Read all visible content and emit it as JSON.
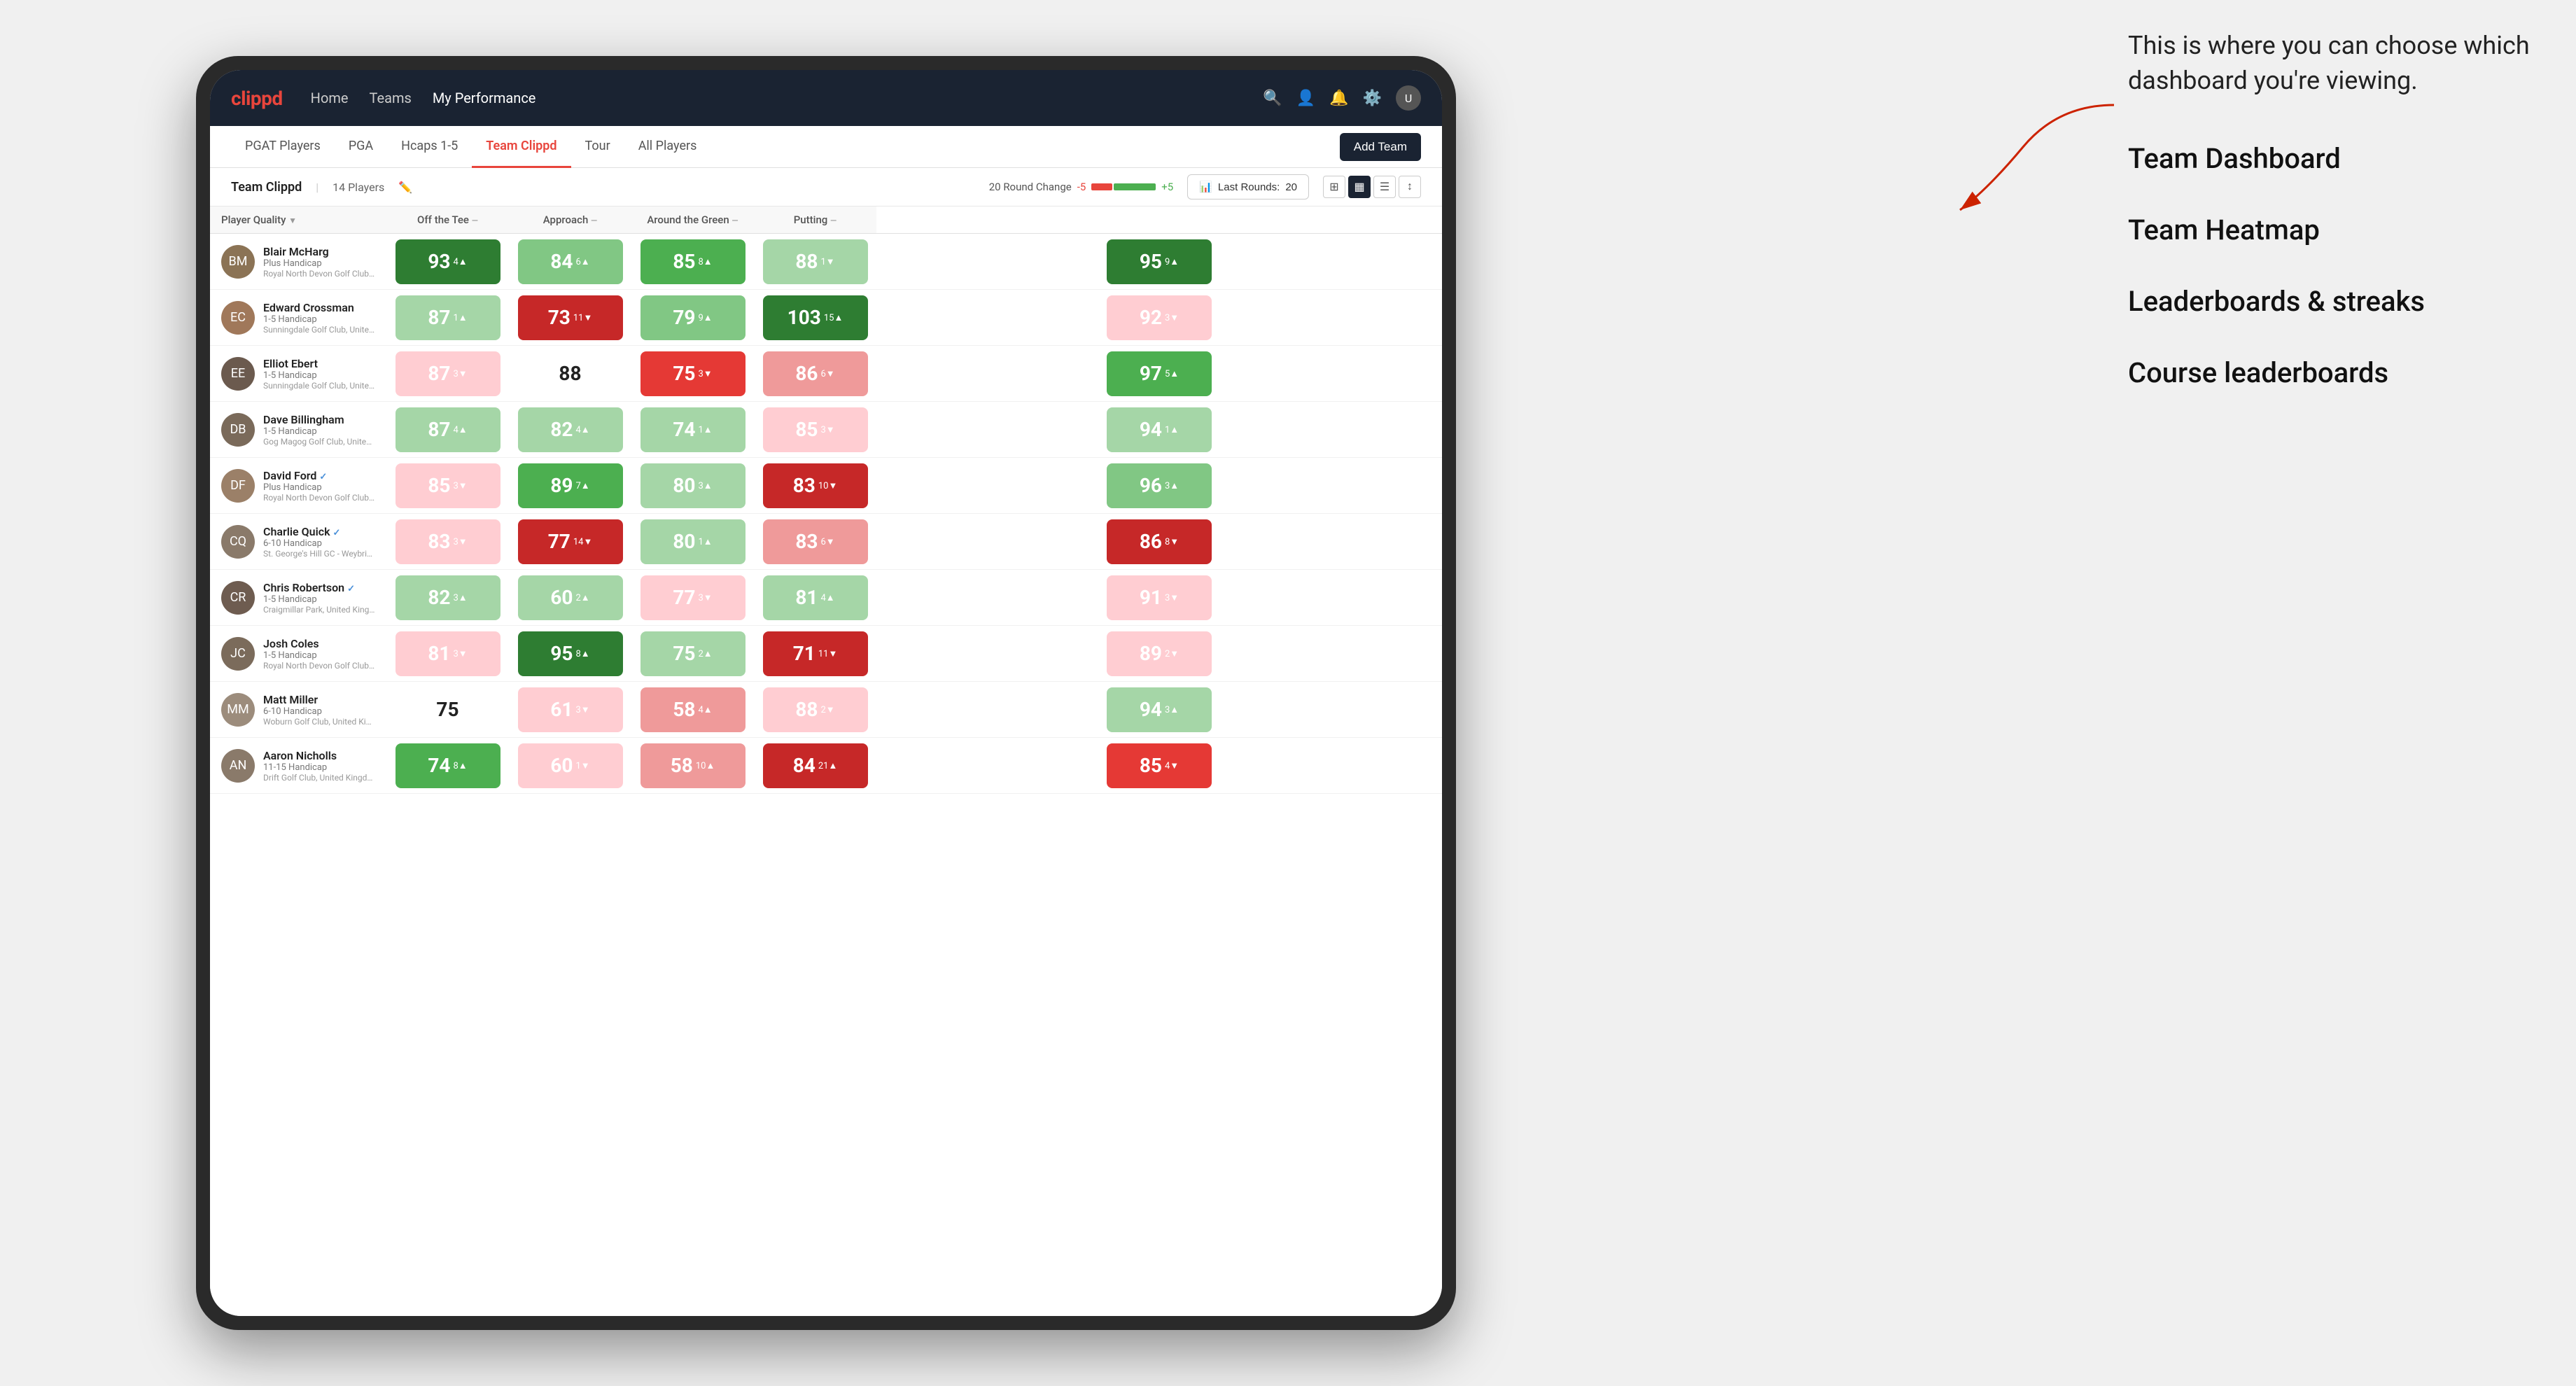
{
  "annotation": {
    "callout": "This is where you can choose which dashboard you're viewing.",
    "items": [
      "Team Dashboard",
      "Team Heatmap",
      "Leaderboards & streaks",
      "Course leaderboards"
    ]
  },
  "nav": {
    "logo": "clippd",
    "links": [
      "Home",
      "Teams",
      "My Performance"
    ],
    "active_link": "My Performance"
  },
  "sub_nav": {
    "links": [
      "PGAT Players",
      "PGA",
      "Hcaps 1-5",
      "Team Clippd",
      "Tour",
      "All Players"
    ],
    "active_link": "Team Clippd",
    "add_team_label": "Add Team"
  },
  "team_info": {
    "name": "Team Clippd",
    "separator": "|",
    "players_count": "14 Players",
    "round_change_label": "20 Round Change",
    "change_minus": "-5",
    "change_plus": "+5",
    "last_rounds_label": "Last Rounds:",
    "last_rounds_value": "20"
  },
  "table": {
    "columns": [
      {
        "label": "Player Quality",
        "sortable": true
      },
      {
        "label": "Off the Tee",
        "sortable": true
      },
      {
        "label": "Approach",
        "sortable": true
      },
      {
        "label": "Around the Green",
        "sortable": true
      },
      {
        "label": "Putting",
        "sortable": true
      }
    ],
    "players": [
      {
        "name": "Blair McHarg",
        "handicap": "Plus Handicap",
        "club": "Royal North Devon Golf Club, United Kingdom",
        "avatar_color": "#8B7355",
        "initials": "BM",
        "metrics": [
          {
            "value": "93",
            "change": "4",
            "dir": "up",
            "color": "green-dark"
          },
          {
            "value": "84",
            "change": "6",
            "dir": "up",
            "color": "green-light"
          },
          {
            "value": "85",
            "change": "8",
            "dir": "up",
            "color": "green-med"
          },
          {
            "value": "88",
            "change": "1",
            "dir": "down",
            "color": "green-pale"
          },
          {
            "value": "95",
            "change": "9",
            "dir": "up",
            "color": "green-dark"
          }
        ]
      },
      {
        "name": "Edward Crossman",
        "handicap": "1-5 Handicap",
        "club": "Sunningdale Golf Club, United Kingdom",
        "avatar_color": "#A0785A",
        "initials": "EC",
        "metrics": [
          {
            "value": "87",
            "change": "1",
            "dir": "up",
            "color": "green-pale"
          },
          {
            "value": "73",
            "change": "11",
            "dir": "down",
            "color": "red-dark"
          },
          {
            "value": "79",
            "change": "9",
            "dir": "up",
            "color": "green-light"
          },
          {
            "value": "103",
            "change": "15",
            "dir": "up",
            "color": "green-dark"
          },
          {
            "value": "92",
            "change": "3",
            "dir": "down",
            "color": "red-pale"
          }
        ]
      },
      {
        "name": "Elliot Ebert",
        "handicap": "1-5 Handicap",
        "club": "Sunningdale Golf Club, United Kingdom",
        "avatar_color": "#6B5A4E",
        "initials": "EE",
        "metrics": [
          {
            "value": "87",
            "change": "3",
            "dir": "down",
            "color": "red-pale"
          },
          {
            "value": "88",
            "change": "",
            "dir": "none",
            "color": "neutral"
          },
          {
            "value": "75",
            "change": "3",
            "dir": "down",
            "color": "red-med"
          },
          {
            "value": "86",
            "change": "6",
            "dir": "down",
            "color": "red-light"
          },
          {
            "value": "97",
            "change": "5",
            "dir": "up",
            "color": "green-med"
          }
        ]
      },
      {
        "name": "Dave Billingham",
        "handicap": "1-5 Handicap",
        "club": "Gog Magog Golf Club, United Kingdom",
        "avatar_color": "#7A6A5A",
        "initials": "DB",
        "metrics": [
          {
            "value": "87",
            "change": "4",
            "dir": "up",
            "color": "green-pale"
          },
          {
            "value": "82",
            "change": "4",
            "dir": "up",
            "color": "green-pale"
          },
          {
            "value": "74",
            "change": "1",
            "dir": "up",
            "color": "green-pale"
          },
          {
            "value": "85",
            "change": "3",
            "dir": "down",
            "color": "red-pale"
          },
          {
            "value": "94",
            "change": "1",
            "dir": "up",
            "color": "green-pale"
          }
        ]
      },
      {
        "name": "David Ford",
        "handicap": "Plus Handicap",
        "club": "Royal North Devon Golf Club, United Kingdom",
        "avatar_color": "#9B8068",
        "initials": "DF",
        "verified": true,
        "metrics": [
          {
            "value": "85",
            "change": "3",
            "dir": "down",
            "color": "red-pale"
          },
          {
            "value": "89",
            "change": "7",
            "dir": "up",
            "color": "green-med"
          },
          {
            "value": "80",
            "change": "3",
            "dir": "up",
            "color": "green-pale"
          },
          {
            "value": "83",
            "change": "10",
            "dir": "down",
            "color": "red-dark"
          },
          {
            "value": "96",
            "change": "3",
            "dir": "up",
            "color": "green-light"
          }
        ]
      },
      {
        "name": "Charlie Quick",
        "handicap": "6-10 Handicap",
        "club": "St. George's Hill GC - Weybridge - Surrey, Uni...",
        "avatar_color": "#8A7A6A",
        "initials": "CQ",
        "verified": true,
        "metrics": [
          {
            "value": "83",
            "change": "3",
            "dir": "down",
            "color": "red-pale"
          },
          {
            "value": "77",
            "change": "14",
            "dir": "down",
            "color": "red-dark"
          },
          {
            "value": "80",
            "change": "1",
            "dir": "up",
            "color": "green-pale"
          },
          {
            "value": "83",
            "change": "6",
            "dir": "down",
            "color": "red-light"
          },
          {
            "value": "86",
            "change": "8",
            "dir": "down",
            "color": "red-dark"
          }
        ]
      },
      {
        "name": "Chris Robertson",
        "handicap": "1-5 Handicap",
        "club": "Craigmillar Park, United Kingdom",
        "avatar_color": "#6E5C50",
        "initials": "CR",
        "verified": true,
        "metrics": [
          {
            "value": "82",
            "change": "3",
            "dir": "up",
            "color": "green-pale"
          },
          {
            "value": "60",
            "change": "2",
            "dir": "up",
            "color": "green-pale"
          },
          {
            "value": "77",
            "change": "3",
            "dir": "down",
            "color": "red-pale"
          },
          {
            "value": "81",
            "change": "4",
            "dir": "up",
            "color": "green-pale"
          },
          {
            "value": "91",
            "change": "3",
            "dir": "down",
            "color": "red-pale"
          }
        ]
      },
      {
        "name": "Josh Coles",
        "handicap": "1-5 Handicap",
        "club": "Royal North Devon Golf Club, United Kingdom",
        "avatar_color": "#7B6B5B",
        "initials": "JC",
        "metrics": [
          {
            "value": "81",
            "change": "3",
            "dir": "down",
            "color": "red-pale"
          },
          {
            "value": "95",
            "change": "8",
            "dir": "up",
            "color": "green-dark"
          },
          {
            "value": "75",
            "change": "2",
            "dir": "up",
            "color": "green-pale"
          },
          {
            "value": "71",
            "change": "11",
            "dir": "down",
            "color": "red-dark"
          },
          {
            "value": "89",
            "change": "2",
            "dir": "down",
            "color": "red-pale"
          }
        ]
      },
      {
        "name": "Matt Miller",
        "handicap": "6-10 Handicap",
        "club": "Woburn Golf Club, United Kingdom",
        "avatar_color": "#9C8C7C",
        "initials": "MM",
        "metrics": [
          {
            "value": "75",
            "change": "",
            "dir": "none",
            "color": "neutral"
          },
          {
            "value": "61",
            "change": "3",
            "dir": "down",
            "color": "red-pale"
          },
          {
            "value": "58",
            "change": "4",
            "dir": "up",
            "color": "red-light"
          },
          {
            "value": "88",
            "change": "2",
            "dir": "down",
            "color": "red-pale"
          },
          {
            "value": "94",
            "change": "3",
            "dir": "up",
            "color": "green-pale"
          }
        ]
      },
      {
        "name": "Aaron Nicholls",
        "handicap": "11-15 Handicap",
        "club": "Drift Golf Club, United Kingdom",
        "avatar_color": "#8A7A6A",
        "initials": "AN",
        "metrics": [
          {
            "value": "74",
            "change": "8",
            "dir": "up",
            "color": "green-med"
          },
          {
            "value": "60",
            "change": "1",
            "dir": "down",
            "color": "red-pale"
          },
          {
            "value": "58",
            "change": "10",
            "dir": "up",
            "color": "red-light"
          },
          {
            "value": "84",
            "change": "21",
            "dir": "up",
            "color": "red-dark"
          },
          {
            "value": "85",
            "change": "4",
            "dir": "down",
            "color": "red-med"
          }
        ]
      }
    ]
  }
}
